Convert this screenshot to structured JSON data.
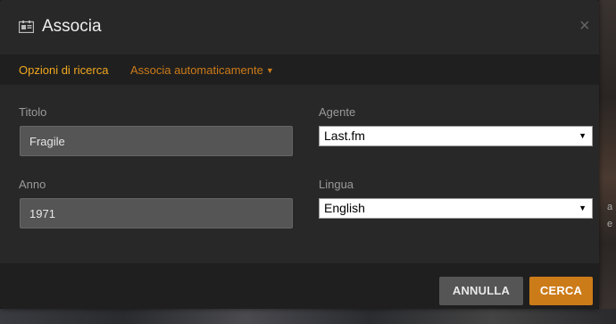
{
  "dialog": {
    "title": "Associa",
    "close_glyph": "×"
  },
  "subnav": {
    "tabs": [
      {
        "label": "Opzioni di ricerca",
        "active": true
      },
      {
        "label": "Associa automaticamente",
        "dropdown": true
      }
    ]
  },
  "form": {
    "title_label": "Titolo",
    "title_value": "Fragile",
    "year_label": "Anno",
    "year_value": "1971",
    "agent_label": "Agente",
    "agent_value": "Last.fm",
    "language_label": "Lingua",
    "language_value": "English"
  },
  "footer": {
    "cancel_label": "ANNULLA",
    "search_label": "CERCA"
  },
  "background": {
    "right_text_1": "a",
    "right_text_2": "e"
  },
  "colors": {
    "accent": "#cc7b19",
    "accent_active": "#f1a81f",
    "panel": "#282828",
    "panel_dark": "#1f1f1f"
  },
  "icons": {
    "title": "id-card-icon",
    "close": "close-icon",
    "caret": "caret-down-icon",
    "select_arrow": "select-arrow-icon"
  }
}
